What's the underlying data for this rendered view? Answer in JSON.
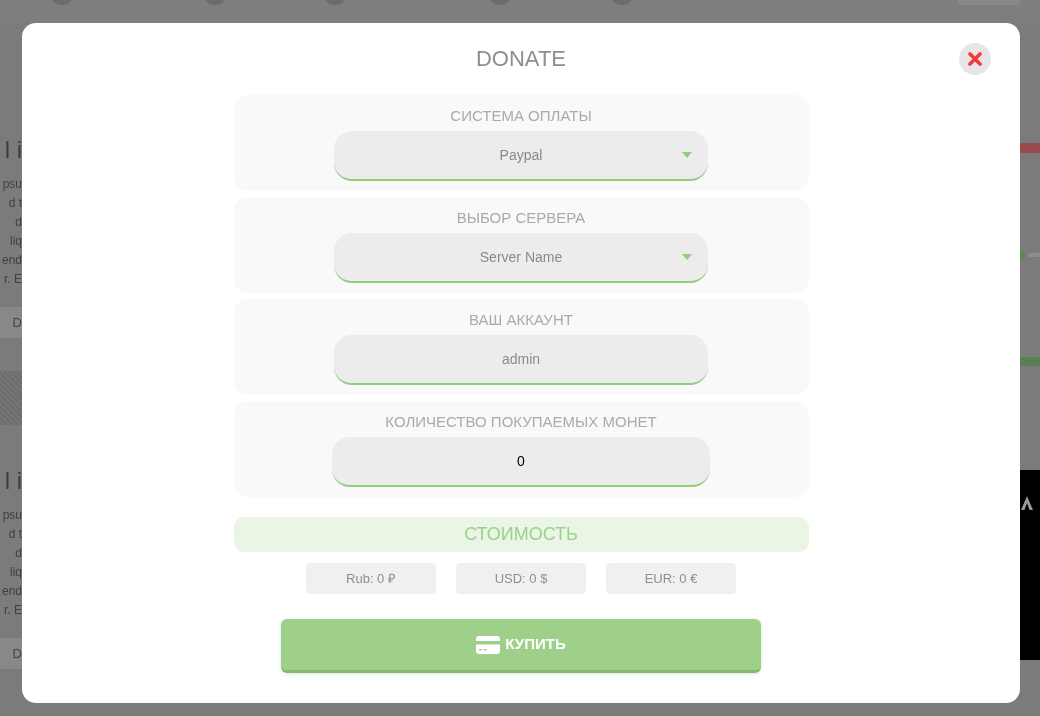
{
  "background_page": {
    "cards": [
      {
        "title": "l i",
        "lines": [
          "psu",
          "d t",
          "d",
          "liq",
          "end",
          "r. E"
        ],
        "button": "D"
      },
      {
        "title": "l i",
        "lines": [
          "psu",
          "d t",
          "d",
          "liq",
          "end",
          "r. E"
        ],
        "button": "D"
      }
    ]
  },
  "dialog": {
    "title": "DONATE",
    "fields": [
      {
        "kind": "select",
        "label": "СИСТЕМА ОПЛАТЫ",
        "value": "Paypal"
      },
      {
        "kind": "select",
        "label": "ВЫБОР СЕРВЕРА",
        "value": "Server Name"
      },
      {
        "kind": "text",
        "label": "ВАШ АККАУНТ",
        "value": "admin"
      },
      {
        "kind": "number",
        "label": "КОЛИЧЕСТВО ПОКУПАЕМЫХ МОНЕТ",
        "value": "0"
      }
    ],
    "cost_heading": "СТОИМОСТЬ",
    "prices": [
      "Rub: 0 ₽",
      "USD: 0 $",
      "EUR: 0 €"
    ],
    "buy_button": "КУПИТЬ"
  }
}
